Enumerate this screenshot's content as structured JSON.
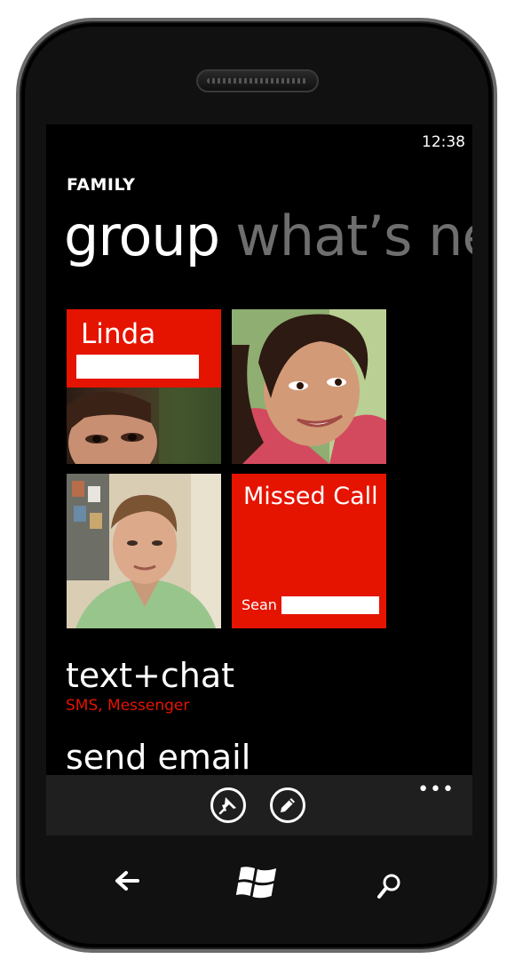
{
  "status": {
    "time": "12:38"
  },
  "header": {
    "app_title": "FAMILY"
  },
  "pivot": {
    "active": "group",
    "next": "what’s ne"
  },
  "tiles": {
    "linda": {
      "name": "Linda"
    },
    "missed_call": {
      "title": "Missed Call",
      "from": "Sean"
    }
  },
  "actions": [
    {
      "title": "text+chat",
      "subtitle": "SMS, Messenger"
    },
    {
      "title": "send email"
    }
  ],
  "appbar": {
    "buttons": [
      "pin-icon",
      "edit-icon"
    ],
    "more": "•••"
  },
  "hardware_buttons": [
    "back-icon",
    "windows-start-icon",
    "search-icon"
  ],
  "colors": {
    "accent": "#e51400",
    "background": "#000000",
    "appbar": "#1f1f1f"
  }
}
